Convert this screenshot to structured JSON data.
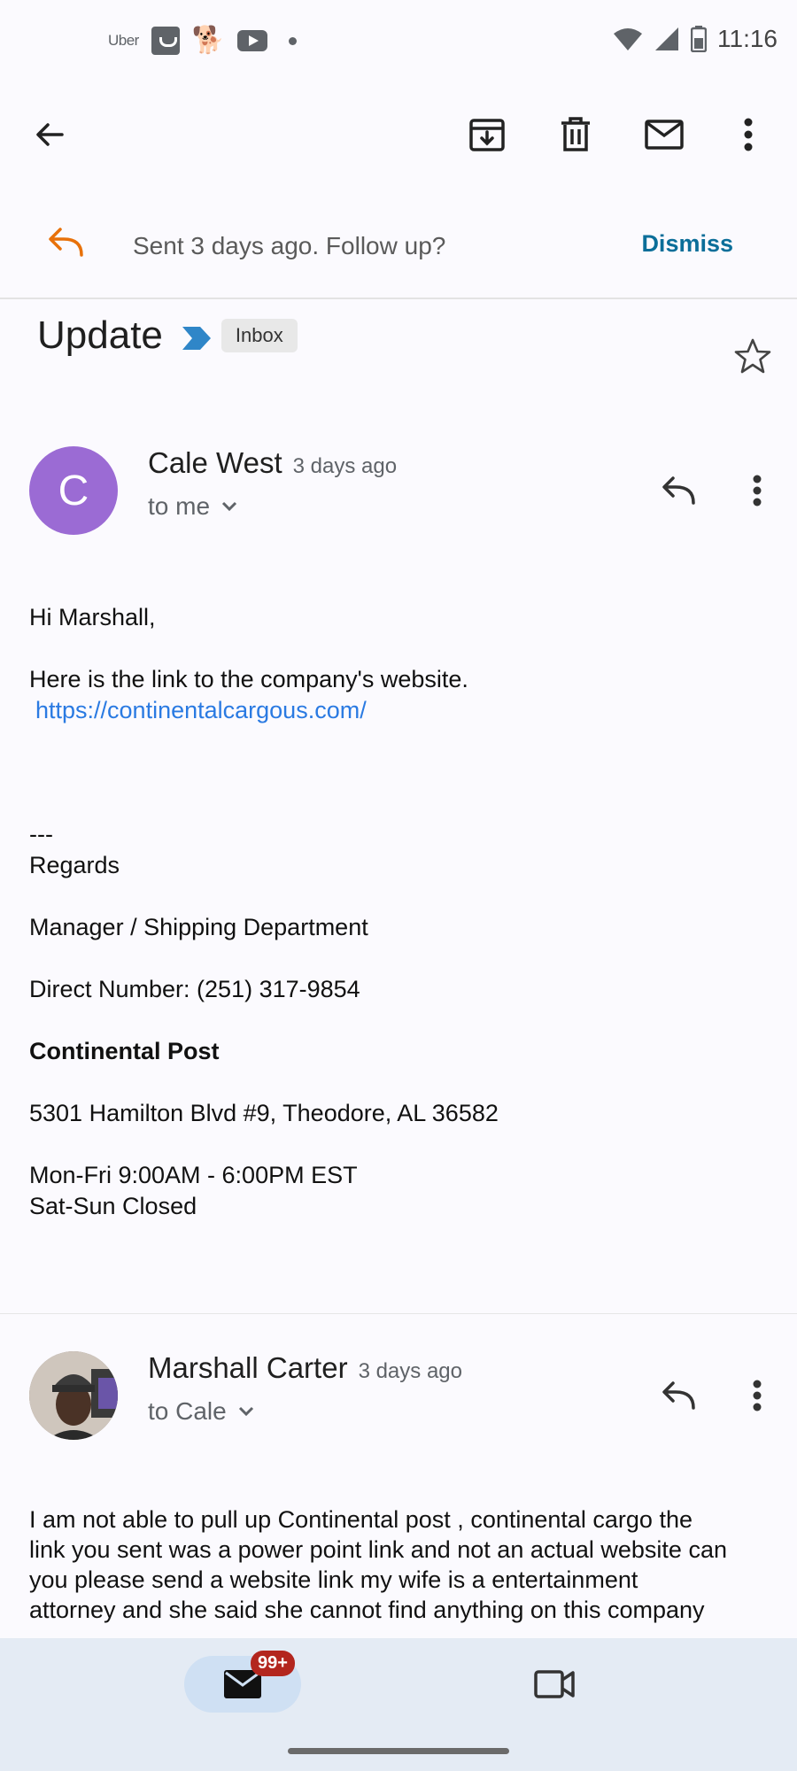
{
  "status_bar": {
    "uber_label": "Uber",
    "time": "11:16"
  },
  "toolbar": {
    "back_icon": "arrow-left-icon",
    "archive_icon": "archive-icon",
    "delete_icon": "trash-icon",
    "mark_unread_icon": "mail-icon",
    "more_icon": "more-vert-icon"
  },
  "followup": {
    "text": "Sent 3 days ago. Follow up?",
    "dismiss_label": "Dismiss",
    "icon_color": "#e8710a"
  },
  "thread": {
    "subject": "Update",
    "label_chip": "Inbox"
  },
  "messages": [
    {
      "avatar_letter": "C",
      "avatar_color": "#9b6bd4",
      "sender": "Cale West",
      "time": "3 days ago",
      "recipient": "to me",
      "greeting": "Hi Marshall,",
      "line1": "Here is the link to the company's website.",
      "link": "https://continentalcargous.com/",
      "sig_sep": "---",
      "regards": "Regards",
      "title": "Manager / Shipping Department",
      "phone": "Direct Number: (251) 317-9854",
      "company": "Continental Post",
      "address": "5301 Hamilton Blvd #9, Theodore, AL 36582",
      "hours1": "Mon-Fri 9:00AM - 6:00PM EST",
      "hours2": "Sat-Sun Closed"
    },
    {
      "sender": "Marshall Carter",
      "time": "3 days ago",
      "recipient": "to Cale",
      "body_lines": [
        "I am not able to pull up Continental post , continental cargo the",
        "link you sent was a power point link and not an actual website can",
        "you please send a website link my wife is a entertainment",
        "attorney and she said she cannot find anything on this company"
      ]
    }
  ],
  "bottom_nav": {
    "mail_badge": "99+",
    "badge_color": "#b3261e"
  }
}
